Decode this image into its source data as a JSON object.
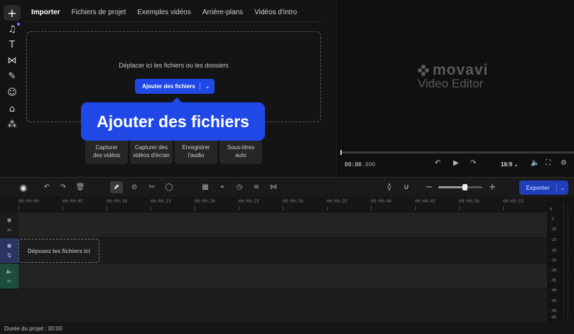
{
  "rail": {
    "items": [
      {
        "name": "add-media",
        "glyph": "+"
      },
      {
        "name": "music",
        "glyph": "♫"
      },
      {
        "name": "titles",
        "glyph": "T"
      },
      {
        "name": "transitions",
        "glyph": "⋈"
      },
      {
        "name": "filters",
        "glyph": "✎"
      },
      {
        "name": "stickers",
        "glyph": "☺"
      },
      {
        "name": "elements",
        "glyph": "⌂"
      },
      {
        "name": "more-tools",
        "glyph": "⁂"
      }
    ]
  },
  "import": {
    "tabs": [
      "Importer",
      "Fichiers de projet",
      "Exemples vidéos",
      "Arrière-plans",
      "Vidéos d'intro"
    ],
    "active_tab": 0,
    "drop_text": "Déplacer ici les fichiers ou les dossiers",
    "add_button": "Ajouter des fichiers",
    "tooltip": "Ajouter des fichiers",
    "quick_actions": [
      {
        "line1": "Capturer",
        "line2": "des vidéos"
      },
      {
        "line1": "Capturer des",
        "line2": "vidéos d'écran"
      },
      {
        "line1": "Enregistrer",
        "line2": "l'audio"
      },
      {
        "line1": "Sous-titres",
        "line2": "auto"
      }
    ]
  },
  "preview": {
    "logo_word": "movavi",
    "logo_sub": "Video Editor",
    "time_main": "00:00",
    "time_ms": ".000",
    "aspect_ratio": "16:9",
    "progress": 0
  },
  "toolbar": {
    "export_label": "Exporter",
    "zoom_level": 0.62
  },
  "ruler": {
    "labels": [
      "00:00:00",
      "00:00:05",
      "00:00:10",
      "00:00:15",
      "00:00:20",
      "00:00:25",
      "00:00:30",
      "00:00:35",
      "00:00:40",
      "00:00:45",
      "00:00:50",
      "00:00:55"
    ]
  },
  "tracks": {
    "drop_label": "Déposez les fichiers ici"
  },
  "meter": {
    "labels": [
      "0",
      "-5",
      "-10",
      "-15",
      "-20",
      "-25",
      "-30",
      "-35",
      "-40",
      "-45",
      "-50",
      "-60"
    ]
  },
  "footer": {
    "duration": "Durée du projet : 00:00"
  },
  "colors": {
    "accent": "#1f48e6",
    "background": "#141414",
    "video_track": "#2b3560",
    "audio_track": "#1f4d3b"
  }
}
